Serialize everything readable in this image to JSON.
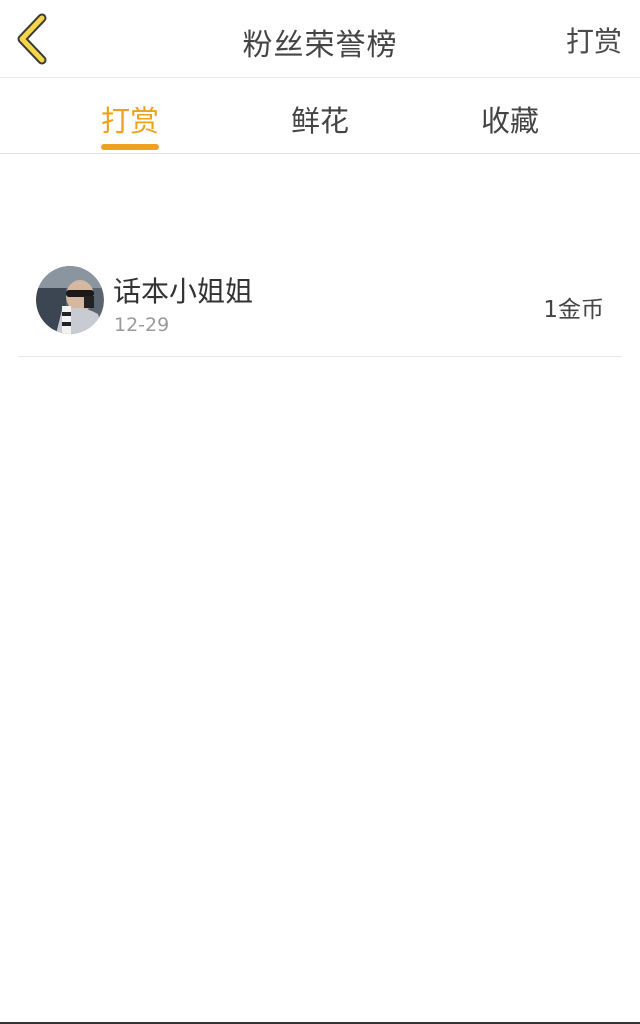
{
  "header": {
    "title": "粉丝荣誉榜",
    "action_label": "打赏",
    "back_icon": "chevron-left-icon",
    "back_icon_color": "#f5c842"
  },
  "tabs": [
    {
      "label": "打赏",
      "active": true
    },
    {
      "label": "鲜花",
      "active": false
    },
    {
      "label": "收藏",
      "active": false
    }
  ],
  "accent_color": "#f0a01e",
  "list": [
    {
      "name": "话本小姐姐",
      "date": "12-29",
      "amount": "1金币",
      "avatar": "user-avatar"
    }
  ]
}
